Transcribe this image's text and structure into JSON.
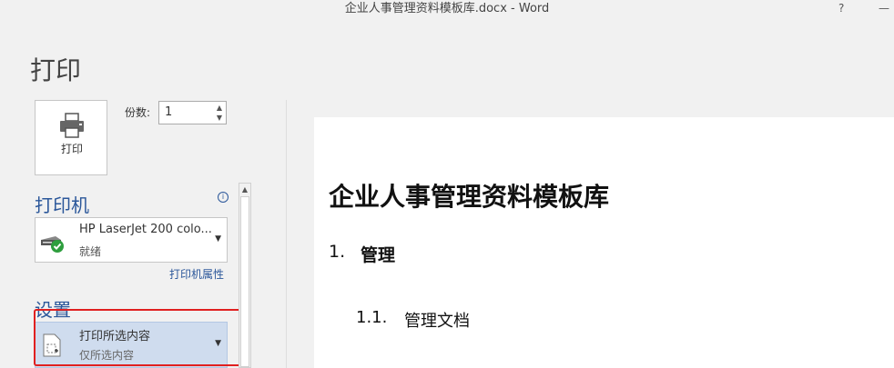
{
  "window": {
    "title": "企业人事管理资料模板库.docx - Word",
    "help_label": "?",
    "minimize_label": "—"
  },
  "page_title": "打印",
  "print_button": {
    "label": "打印",
    "icon": "printer-icon"
  },
  "copies": {
    "label": "份数:",
    "value": "1"
  },
  "printer_section": {
    "title": "打印机",
    "info_icon": "info-icon",
    "printer": {
      "name": "HP LaserJet 200 colo...",
      "status": "就绪",
      "icon": "printer-ready-icon"
    },
    "properties_link": "打印机属性"
  },
  "settings_section": {
    "title": "设置",
    "selected_option": {
      "title": "打印所选内容",
      "subtitle": "仅所选内容",
      "icon": "selection-page-icon"
    }
  },
  "preview": {
    "doc_title": "企业人事管理资料模板库",
    "heading1": {
      "number": "1.",
      "text": "管理"
    },
    "heading2": {
      "number": "1.1.",
      "text": "管理文档"
    }
  },
  "colors": {
    "accent": "#2b579a",
    "selected_bg": "#cfdcee",
    "highlight_border": "#e02020"
  }
}
